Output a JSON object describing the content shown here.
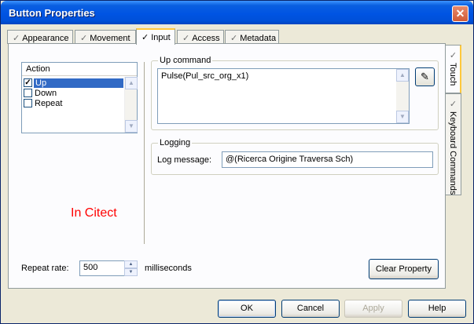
{
  "window": {
    "title": "Button Properties",
    "close_glyph": "✕"
  },
  "tabs": [
    {
      "label": "Appearance",
      "active": false
    },
    {
      "label": "Movement",
      "active": false
    },
    {
      "label": "Input",
      "active": true
    },
    {
      "label": "Access",
      "active": false
    },
    {
      "label": "Metadata",
      "active": false
    }
  ],
  "side_tabs": [
    {
      "label": "Touch",
      "active": true
    },
    {
      "label": "Keyboard Commands",
      "active": false
    }
  ],
  "action": {
    "header": "Action",
    "items": [
      {
        "label": "Up",
        "checked": true,
        "selected": true
      },
      {
        "label": "Down",
        "checked": false,
        "selected": false
      },
      {
        "label": "Repeat",
        "checked": false,
        "selected": false
      }
    ]
  },
  "up_command": {
    "legend": "Up command",
    "value": "Pulse(Pul_src_org_x1)"
  },
  "logging": {
    "legend": "Logging",
    "log_label": "Log message:",
    "log_value": "@(Ricerca Origine Traversa Sch)"
  },
  "note": "In Citect",
  "repeat": {
    "label": "Repeat rate:",
    "value": "500",
    "unit": "milliseconds"
  },
  "buttons": {
    "clear_property": "Clear Property",
    "ok": "OK",
    "cancel": "Cancel",
    "apply": "Apply",
    "help": "Help"
  },
  "colors": {
    "titlebar": "#0054e3",
    "dialog_bg": "#ece9d8",
    "note": "#ff0000",
    "selection": "#316ac5"
  }
}
